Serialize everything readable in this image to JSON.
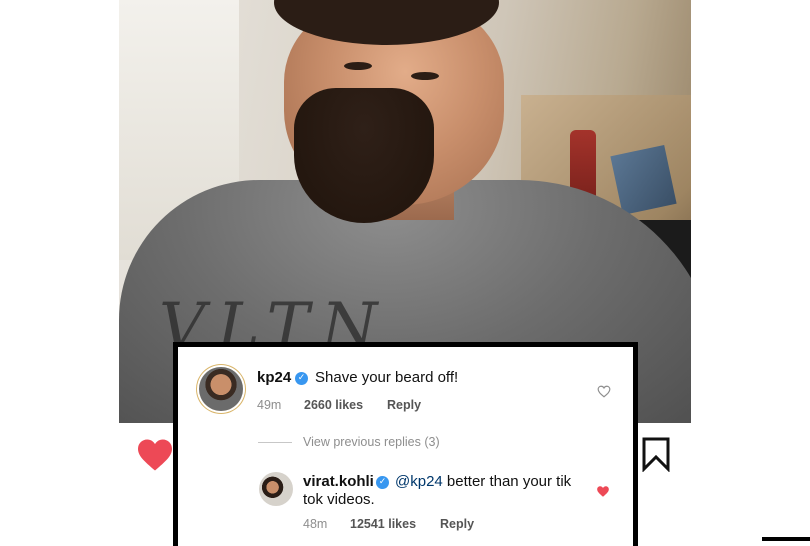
{
  "post": {
    "photo_alt": "",
    "sweater_print": "VLTN"
  },
  "actions": {
    "like_icon": "heart-filled-icon",
    "save_icon": "bookmark-icon",
    "like_color": "#ed4956"
  },
  "comments": [
    {
      "username": "kp24",
      "verified": true,
      "text": "Shave your beard off!",
      "time": "49m",
      "likes": "2660 likes",
      "reply": "Reply",
      "liked": false
    },
    {
      "username": "virat.kohli",
      "verified": true,
      "mention": "@kp24",
      "text": " better than your tik",
      "text_line2": "tok videos.",
      "time": "48m",
      "likes": "12541 likes",
      "reply": "Reply",
      "liked": true
    }
  ],
  "view_previous": "View previous replies (3)",
  "colors": {
    "mention": "#00376b",
    "verified": "#3897f0",
    "meta": "#8e8e8e"
  }
}
